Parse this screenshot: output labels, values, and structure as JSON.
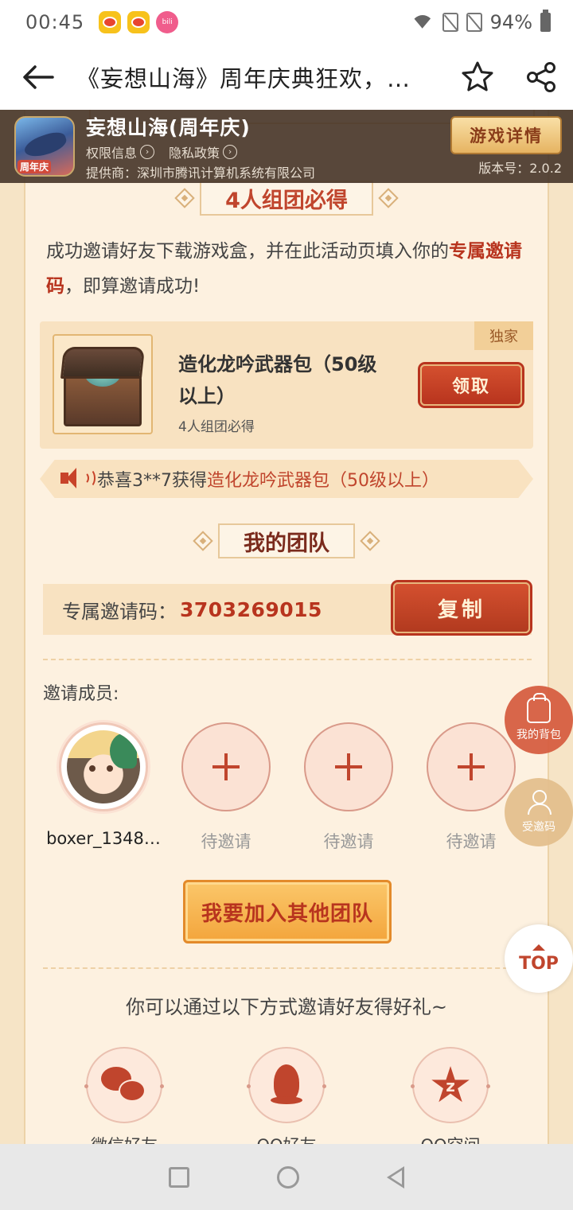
{
  "status_bar": {
    "time": "00:45",
    "battery": "94%"
  },
  "nav": {
    "title": "《妄想山海》周年庆典狂欢，…"
  },
  "game": {
    "name": "妄想山海(周年庆)",
    "icon_badge": "周年庆",
    "permissions_label": "权限信息",
    "privacy_label": "隐私政策",
    "provider": "提供商：深圳市腾讯计算机系统有限公司",
    "detail_button": "游戏详情",
    "version": "版本号：2.0.2"
  },
  "section1": {
    "heading": "4人组团必得",
    "desc_before": "成功邀请好友下载游戏盒，并在此活动页填入你的",
    "desc_highlight": "专属邀请码",
    "desc_after": "，即算邀请成功!"
  },
  "reward": {
    "tag": "独家",
    "name": "造化龙吟武器包（50级以上）",
    "subtitle": "4人组团必得",
    "claim_button": "领取"
  },
  "broadcast": {
    "prefix": "恭喜3**7获得",
    "item": "造化龙吟武器包（50级以上）"
  },
  "team": {
    "heading": "我的团队",
    "code_label": "专属邀请码：",
    "code_value": "3703269015",
    "copy_button": "复制",
    "members_label": "邀请成员:",
    "members": [
      {
        "name": "boxer_1348…",
        "status": "joined"
      },
      {
        "name": "待邀请",
        "status": "pending"
      },
      {
        "name": "待邀请",
        "status": "pending"
      },
      {
        "name": "待邀请",
        "status": "pending"
      }
    ],
    "join_button": "我要加入其他团队"
  },
  "share": {
    "title": "你可以通过以下方式邀请好友得好礼~",
    "channels": [
      {
        "label": "微信好友",
        "icon": "wechat-icon"
      },
      {
        "label": "QQ好友",
        "icon": "qq-icon"
      },
      {
        "label": "QQ空间",
        "icon": "qzone-icon"
      }
    ]
  },
  "floating": {
    "bag_label": "我的背包",
    "code_label": "受邀码",
    "top_label": "TOP"
  },
  "colors": {
    "accent_red": "#c0452d",
    "page_bg": "#fdf1e0",
    "gold": "#e4c08e"
  }
}
